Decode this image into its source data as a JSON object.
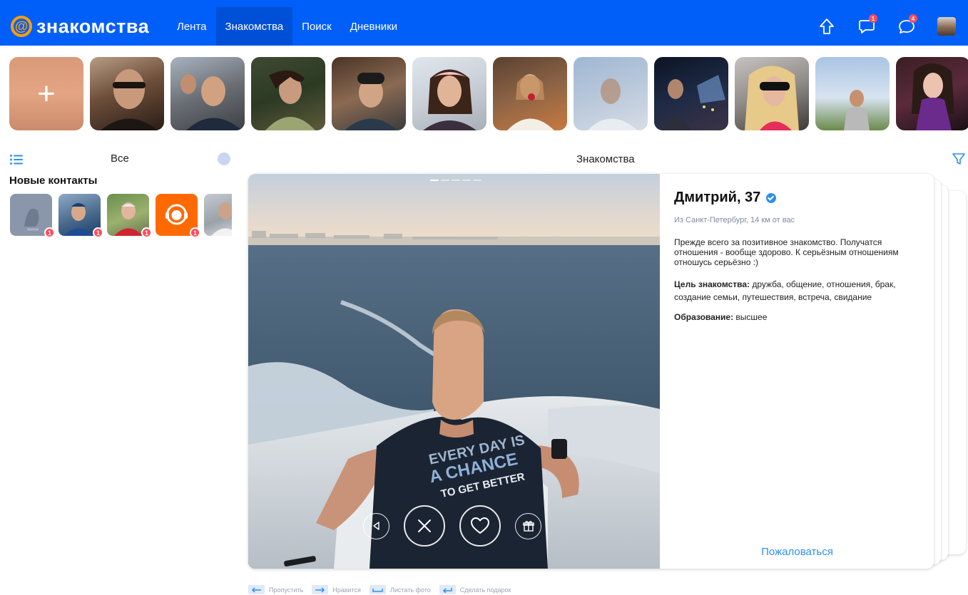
{
  "header": {
    "logo_symbol": "@",
    "logo_text": "знакомства",
    "nav": [
      {
        "label": "Лента",
        "active": false
      },
      {
        "label": "Знакомства",
        "active": true
      },
      {
        "label": "Поиск",
        "active": false
      },
      {
        "label": "Дневники",
        "active": false
      }
    ],
    "icons": [
      {
        "name": "arrow-up-icon"
      },
      {
        "name": "chat-icon",
        "badge": "1"
      },
      {
        "name": "messages-icon",
        "badge": "4"
      },
      {
        "name": "user-avatar"
      }
    ],
    "brand_color": "#005ff9",
    "accent_color": "#ff9e00"
  },
  "stories": {
    "add_label": "+",
    "items": [
      "story-1",
      "story-2",
      "story-3",
      "story-4",
      "story-5",
      "story-6",
      "story-7",
      "story-8",
      "story-9",
      "story-10",
      "story-11"
    ]
  },
  "sidebar": {
    "filter_label": "Все",
    "new_contacts_title": "Новые контакты",
    "contacts": [
      {
        "badge": "1"
      },
      {
        "badge": "1"
      },
      {
        "badge": "1"
      },
      {
        "badge": "1"
      },
      {
        "badge": ""
      }
    ]
  },
  "main": {
    "section_title": "Знакомства"
  },
  "profile": {
    "name": "Дмитрий, 37",
    "location": "Из Санкт-Петербург, 14 км от вас",
    "about": "Прежде всего за позитивное знакомство. Получатся отношения - вообще здорово. К серьёзным отношениям отношусь серьёзно :)",
    "goal_label": "Цель знакомства:",
    "goal_value": " дружба, общение, отношения, брак, создание семьи, путешествия, встреча, свидание",
    "education_label": "Образование:",
    "education_value": " высшее",
    "complain_label": "Пожаловаться",
    "tshirt_text": [
      "EVERY DAY IS",
      "A CHANCE",
      "TO GET BETTER"
    ]
  },
  "hotkeys": [
    {
      "label": "Пропустить"
    },
    {
      "label": "Нравится"
    },
    {
      "label": "Листать фото"
    },
    {
      "label": "Сделать подарок"
    }
  ]
}
